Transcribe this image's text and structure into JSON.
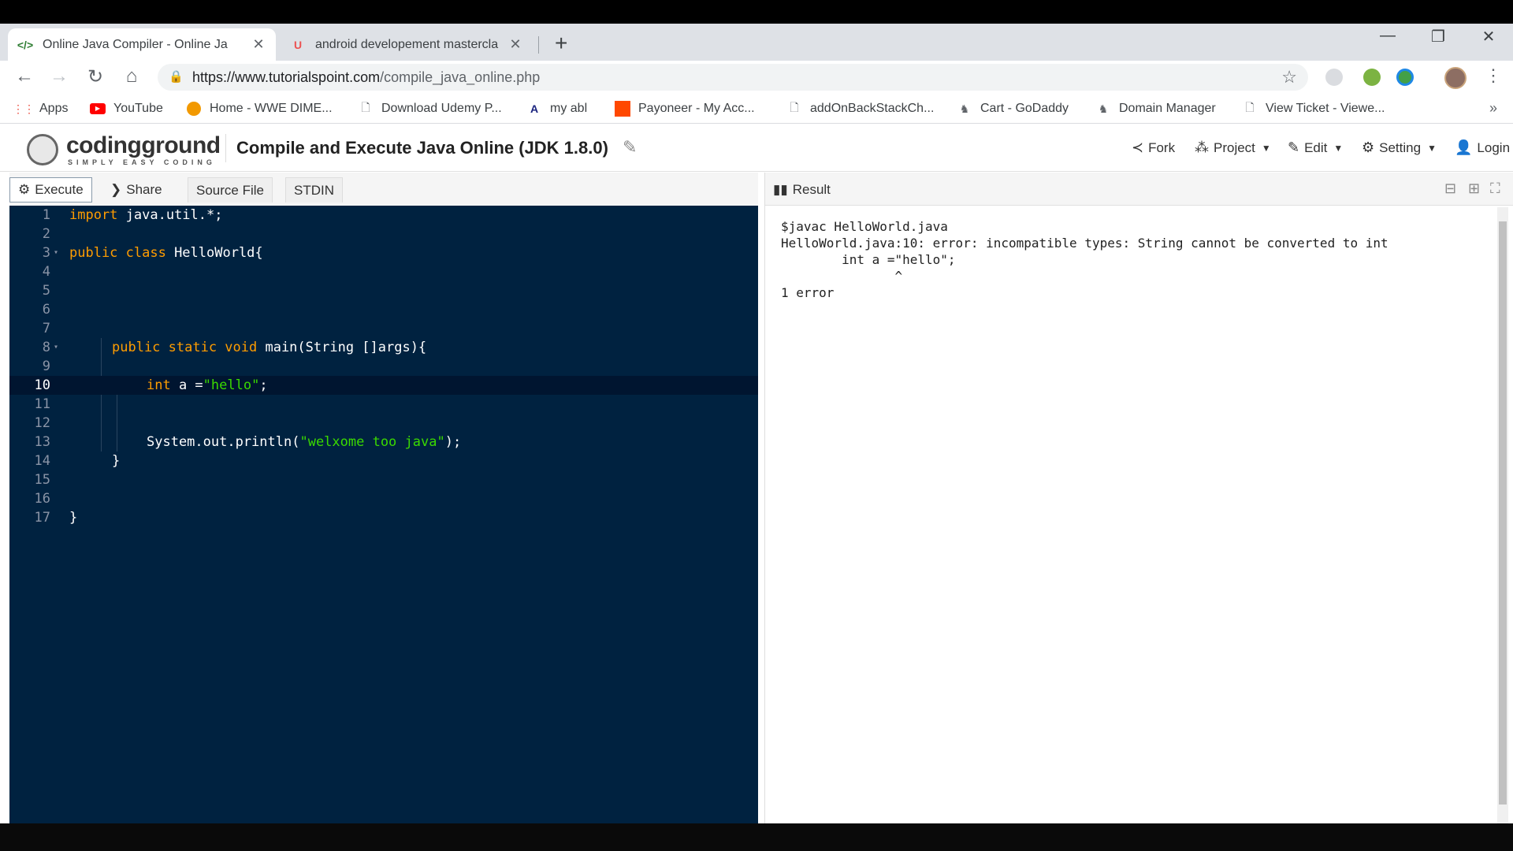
{
  "browser": {
    "tabs": [
      {
        "title": "Online Java Compiler - Online Ja",
        "icon": "code-icon",
        "active": true
      },
      {
        "title": "android developement mastercla",
        "icon": "udemy-icon",
        "active": false
      }
    ],
    "new_tab": "+",
    "window_controls": {
      "minimize": "—",
      "restore": "❐",
      "close": "✕"
    },
    "url_base": "https://www.tutorialspoint.com",
    "url_path": "/compile_java_online.php"
  },
  "bookmarks": [
    {
      "label": "Apps",
      "icon": "apps-grid-icon",
      "color": "#ea4335"
    },
    {
      "label": "YouTube",
      "icon": "youtube-icon",
      "color": "#ff0000"
    },
    {
      "label": "Home - WWE DIME...",
      "icon": "wwe-icon",
      "color": "#f29900"
    },
    {
      "label": "Download Udemy P...",
      "icon": "page-icon",
      "color": "#5f6368"
    },
    {
      "label": "my abl",
      "icon": "abl-icon",
      "color": "#1a237e"
    },
    {
      "label": "Payoneer - My Acc...",
      "icon": "payoneer-icon",
      "color": "#ff4800"
    },
    {
      "label": "addOnBackStackCh...",
      "icon": "page-icon",
      "color": "#5f6368"
    },
    {
      "label": "Cart - GoDaddy",
      "icon": "godaddy-icon",
      "color": "#1bdbdb"
    },
    {
      "label": "Domain Manager",
      "icon": "godaddy-icon",
      "color": "#1bdbdb"
    },
    {
      "label": "View Ticket - Viewe...",
      "icon": "page-icon",
      "color": "#5f6368"
    }
  ],
  "site": {
    "logo_main": "codingground",
    "logo_sub": "SIMPLY EASY CODING",
    "title": "Compile and Execute Java Online (JDK 1.8.0)",
    "nav": [
      {
        "label": "Fork",
        "icon": "fork-icon",
        "caret": false
      },
      {
        "label": "Project",
        "icon": "project-icon",
        "caret": true
      },
      {
        "label": "Edit",
        "icon": "edit-icon",
        "caret": true
      },
      {
        "label": "Setting",
        "icon": "gear-icon",
        "caret": true
      },
      {
        "label": "Login",
        "icon": "user-icon",
        "caret": false
      }
    ]
  },
  "editor": {
    "tabs": {
      "execute": "Execute",
      "share": "Share",
      "source": "Source File",
      "stdin": "STDIN"
    },
    "line_numbers": [
      "1",
      "2",
      "3",
      "4",
      "5",
      "6",
      "7",
      "8",
      "9",
      "10",
      "11",
      "12",
      "13",
      "14",
      "15",
      "16",
      "17"
    ],
    "code": {
      "l1_kw": "import",
      "l1_rest": " java.util.*;",
      "l3_kw": "public class",
      "l3_rest": " HelloWorld{",
      "l8_kw": "public static void",
      "l8_rest": " main(String []args){",
      "l10_kw": "int",
      "l10_mid": " a =",
      "l10_str": "\"hello\"",
      "l10_end": ";",
      "l13_pre": "System.out.println(",
      "l13_str": "\"welxome too java\"",
      "l13_end": ");",
      "l14": "}",
      "l17": "}"
    }
  },
  "result": {
    "label": "Result",
    "output": "$javac HelloWorld.java\nHelloWorld.java:10: error: incompatible types: String cannot be converted to int\n        int a =\"hello\";\n               ^\n1 error"
  }
}
